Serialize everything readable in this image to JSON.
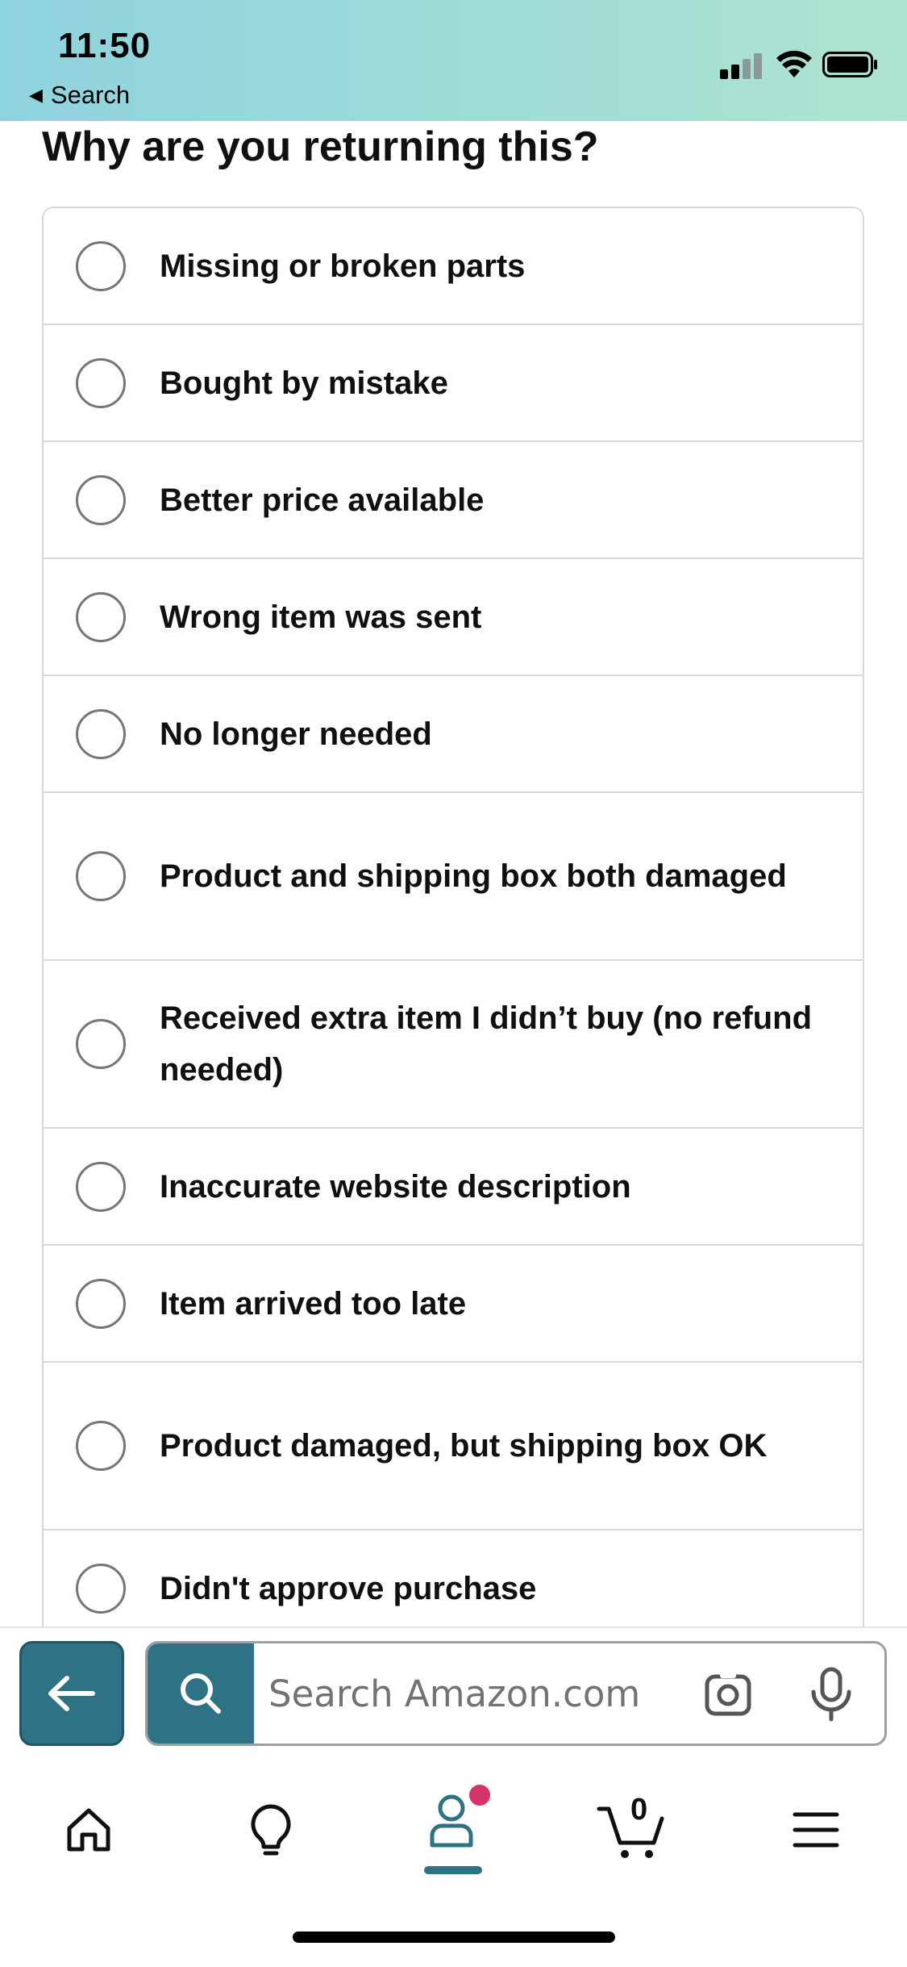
{
  "status_bar": {
    "time": "11:50",
    "back_app_label": "Search"
  },
  "page": {
    "title": "Why are you returning this?"
  },
  "reasons": [
    {
      "label": "Missing or broken parts",
      "selected": false
    },
    {
      "label": "Bought by mistake",
      "selected": false
    },
    {
      "label": "Better price available",
      "selected": false
    },
    {
      "label": "Wrong item was sent",
      "selected": false
    },
    {
      "label": "No longer needed",
      "selected": false
    },
    {
      "label": "Product and shipping box both damaged",
      "selected": false
    },
    {
      "label": "Received extra item I didn’t buy (no refund needed)",
      "selected": false
    },
    {
      "label": "Inaccurate website description",
      "selected": false
    },
    {
      "label": "Item arrived too late",
      "selected": false
    },
    {
      "label": "Product damaged, but shipping box OK",
      "selected": false
    },
    {
      "label": "Didn't approve purchase",
      "selected": false
    }
  ],
  "search": {
    "placeholder": "Search Amazon.com"
  },
  "tab_bar": {
    "items": [
      {
        "name": "home",
        "icon": "home-icon"
      },
      {
        "name": "ideas",
        "icon": "lightbulb-icon"
      },
      {
        "name": "account",
        "icon": "person-icon",
        "active": true
      },
      {
        "name": "cart",
        "icon": "cart-icon"
      },
      {
        "name": "menu",
        "icon": "hamburger-icon"
      }
    ],
    "cart_count": "0"
  },
  "colors": {
    "accent": "#2f7286",
    "notification": "#d6336c",
    "border": "#d5d9d9"
  }
}
